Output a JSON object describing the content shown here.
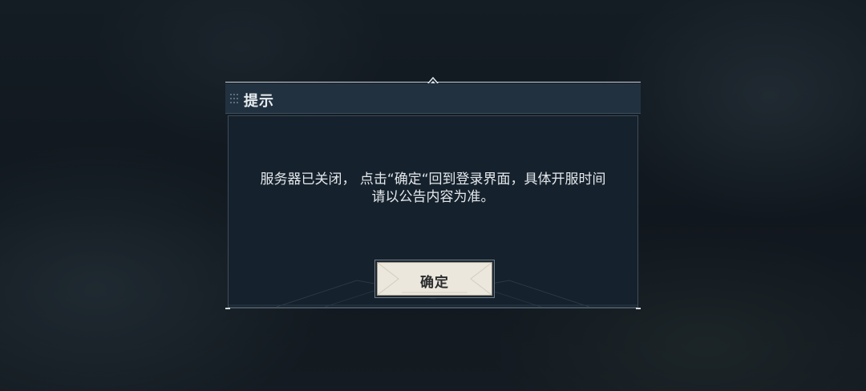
{
  "dialog": {
    "title": "提示",
    "message_line1": "服务器已关闭， 点击“确定“回到登录界面，具体开服时间",
    "message_line2": "请以公告内容为准。",
    "confirm_label": "确定"
  },
  "icons": {
    "grip": "drag-grip-icon",
    "ornament": "diamond-ornament-icon"
  },
  "colors": {
    "header_bg": "#223140",
    "body_bg": "#15212c",
    "button_bg": "#ece7dc",
    "text": "#e4e8ec"
  }
}
